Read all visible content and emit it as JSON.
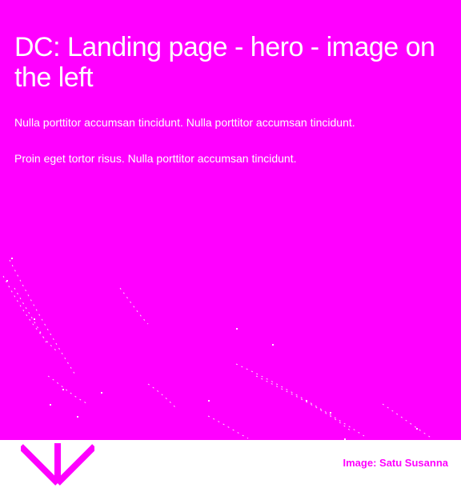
{
  "hero": {
    "title": "DC: Landing page - hero - image on the left",
    "paragraph_1": "Nulla porttitor accumsan tincidunt. Nulla porttitor accumsan tincidunt.",
    "paragraph_2": "Proin eget tortor risus. Nulla porttitor accumsan tincidunt.",
    "background_color": "#ff00ff",
    "text_color": "#ffffff"
  },
  "image": {
    "credit": "Image: Satu Susanna"
  },
  "scroll_button": {
    "icon": "chevron-down-arrow-icon",
    "color": "#ff00ff"
  }
}
